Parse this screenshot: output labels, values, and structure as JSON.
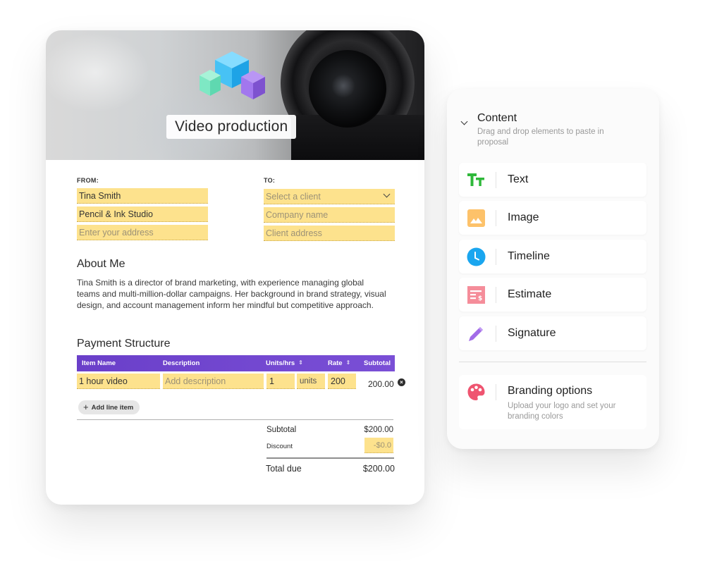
{
  "proposal": {
    "hero_title": "Video production",
    "from": {
      "label": "FROM:",
      "name_value": "Tina Smith",
      "company_value": "Pencil & Ink Studio",
      "address_placeholder": "Enter your address"
    },
    "to": {
      "label": "TO:",
      "client_select_placeholder": "Select a client",
      "company_placeholder": "Company name",
      "address_placeholder": "Client address"
    },
    "about": {
      "heading": "About Me",
      "body": "Tina Smith is a director of brand marketing, with experience managing global teams and multi-million-dollar campaigns. Her background in brand strategy, visual design, and account management inform her mindful but competitive approach."
    },
    "payment": {
      "heading": "Payment Structure",
      "columns": [
        "Item Name",
        "Description",
        "Units/hrs",
        "Rate",
        "Subtotal"
      ],
      "sort_icon": "⇕",
      "rows": [
        {
          "item_name": "1 hour video",
          "description_placeholder": "Add description",
          "units": "1",
          "unit_type": "units",
          "rate": "200",
          "subtotal": "200.00"
        }
      ],
      "remove_icon": "×",
      "add_line_label": "Add line item",
      "add_icon": "+"
    },
    "summary": {
      "subtotal_label": "Subtotal",
      "subtotal_value": "$200.00",
      "discount_label": "Discount",
      "discount_placeholder": "-$0.0",
      "total_label": "Total due",
      "total_value": "$200.00"
    }
  },
  "panel": {
    "title": "Content",
    "subtitle": "Drag and drop elements to paste in proposal",
    "items": [
      {
        "label": "Text",
        "icon": "text-icon",
        "color": "#2fb83a"
      },
      {
        "label": "Image",
        "icon": "image-icon",
        "color": "#fdc26a"
      },
      {
        "label": "Timeline",
        "icon": "clock-icon",
        "color": "#1aa6ef"
      },
      {
        "label": "Estimate",
        "icon": "receipt-icon",
        "color": "#f58d9a"
      },
      {
        "label": "Signature",
        "icon": "pencil-icon",
        "color": "#a26be8"
      }
    ],
    "branding": {
      "label": "Branding options",
      "description": "Upload your logo and set your branding colors",
      "icon": "palette-icon",
      "color": "#ef5470"
    }
  },
  "colors": {
    "table_header": "#6a3fc9",
    "field_fill": "#fde28d"
  }
}
